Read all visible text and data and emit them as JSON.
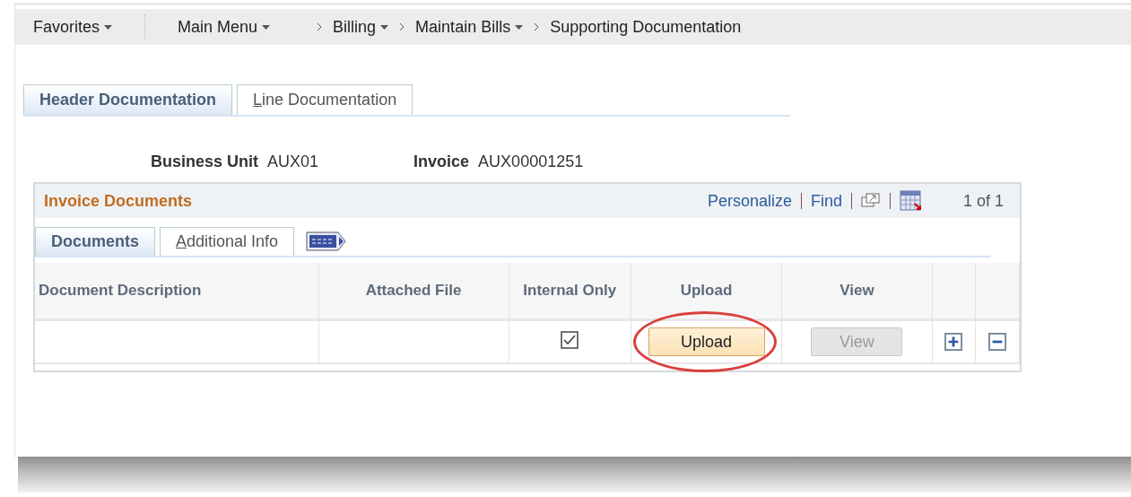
{
  "breadcrumbs": [
    {
      "label": "Favorites",
      "kind": "menu",
      "has_menu": true
    },
    {
      "label": "Main Menu",
      "kind": "menu",
      "has_menu": true
    },
    {
      "label": "Billing",
      "kind": "crumb",
      "has_menu": true
    },
    {
      "label": "Maintain Bills",
      "kind": "crumb",
      "has_menu": true
    },
    {
      "label": "Supporting Documentation",
      "kind": "crumb",
      "has_menu": false
    }
  ],
  "page_tabs": [
    {
      "label": "Header Documentation",
      "selected": true
    },
    {
      "label": "Line Documentation",
      "selected": false
    }
  ],
  "fields": [
    {
      "label": "Business Unit",
      "value": "AUX01"
    },
    {
      "label": "Invoice",
      "value": "AUX00001251"
    }
  ],
  "grid": {
    "title": "Invoice Documents",
    "links": [
      "Personalize",
      "Find"
    ],
    "count": "1 of 1",
    "tabs": [
      {
        "label": "Documents",
        "selected": true
      },
      {
        "label": "Additional Info",
        "selected": false
      }
    ],
    "columns": [
      "Document Description",
      "Attached File",
      "Internal Only",
      "Upload",
      "View"
    ],
    "rows": [
      {
        "internal_only": true,
        "upload": "Upload",
        "upload_highlighted": true,
        "view": "View",
        "view_disabled": true
      }
    ]
  }
}
